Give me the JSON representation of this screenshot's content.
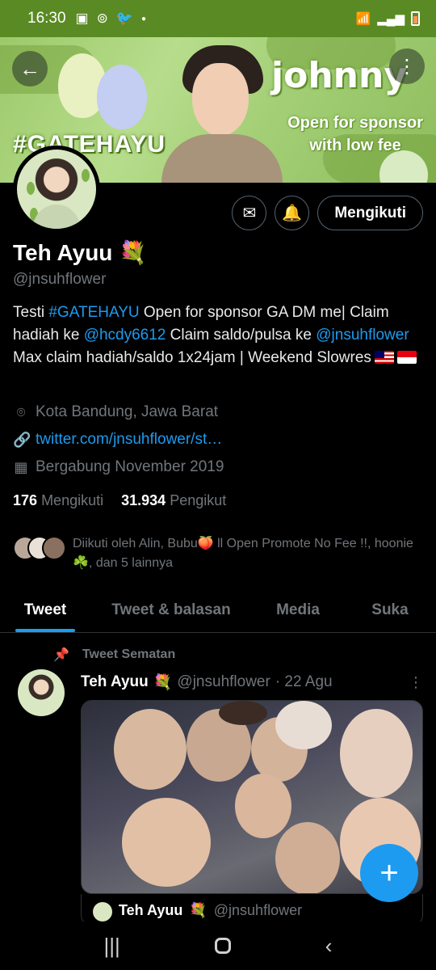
{
  "status_bar": {
    "time": "16:30",
    "notif_icons": [
      "gallery-icon",
      "sync-icon",
      "twitter-icon",
      "dot-icon"
    ],
    "right_icons": [
      "wifi-icon",
      "signal-icon",
      "battery-icon"
    ]
  },
  "banner": {
    "hashtag_text": "#GATEHAYU",
    "name_art": "johnny",
    "sponsor_line1": "Open for sponsor",
    "sponsor_line2": "with low fee"
  },
  "profile": {
    "display_name": "Teh Ayuu",
    "name_emoji": "💐",
    "handle": "@jnsuhflower",
    "bio": {
      "p1": "Testi ",
      "hashtag": "#GATEHAYU",
      "p2": " Open for sponsor GA DM me| Claim hadiah ke ",
      "mention1": "@hcdy6612",
      "p3": " Claim saldo/pulsa ke ",
      "mention2": "@jnsuhflower",
      "p4": " Max claim hadiah/saldo 1x24jam | Weekend Slowres"
    },
    "location": "Kota Bandung, Jawa Barat",
    "website": "twitter.com/jnsuhflower/st…",
    "joined": "Bergabung November 2019",
    "following_count": "176",
    "following_label": "Mengikuti",
    "followers_count": "31.934",
    "followers_label": "Pengikut",
    "followed_by": "Diikuti oleh Alin, Bubu🍑 ll Open Promote No Fee !!, hoonie ☘️, dan 5 lainnya",
    "follow_button": "Mengikuti"
  },
  "tabs": [
    {
      "label": "Tweet",
      "active": true
    },
    {
      "label": "Tweet & balasan",
      "active": false
    },
    {
      "label": "Media",
      "active": false
    },
    {
      "label": "Suka",
      "active": false
    }
  ],
  "pinned_tweet": {
    "pinned_label": "Tweet Sematan",
    "author_name": "Teh Ayuu",
    "author_emoji": "💐",
    "author_handle": "@jnsuhflower",
    "date": "· 22 Agu",
    "quote_name": "Teh Ayuu",
    "quote_emoji": "💐",
    "quote_handle": "@jnsuhflower"
  },
  "colors": {
    "accent": "#1d9bf0",
    "status_bar": "#5a8a23",
    "background": "#000000",
    "muted_text": "#71767b"
  }
}
